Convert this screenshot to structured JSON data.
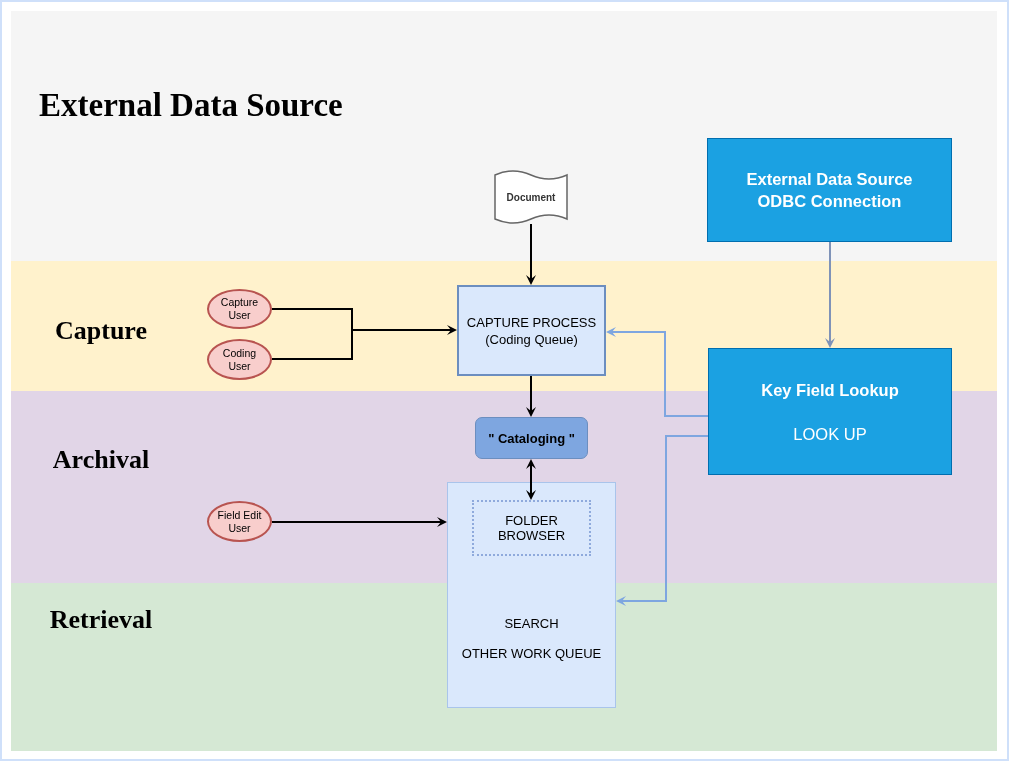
{
  "lanes": [
    {
      "label": "External Data Source",
      "color": "#f5f5f5"
    },
    {
      "label": "Capture",
      "color": "#fff2cc"
    },
    {
      "label": "Archival",
      "color": "#e1d5e7"
    },
    {
      "label": "Retrieval",
      "color": "#d5e8d4"
    }
  ],
  "nodes": [
    {
      "kind": "document",
      "text": "Document"
    },
    {
      "kind": "actor",
      "text": "Capture\nUser"
    },
    {
      "kind": "actor",
      "text": "Coding\nUser"
    },
    {
      "kind": "actor",
      "text": "Field Edit\nUser"
    },
    {
      "kind": "process",
      "text": "CAPTURE PROCESS\n(Coding Queue)"
    },
    {
      "kind": "rounded",
      "text": "\" Cataloging \""
    },
    {
      "kind": "container",
      "inner": "FOLDER\nBROWSER",
      "lines": [
        "SEARCH",
        "OTHER WORK QUEUE"
      ]
    },
    {
      "kind": "service",
      "text": "External Data Source\nODBC Connection"
    },
    {
      "kind": "lookup",
      "title": "Key Field Lookup",
      "subtitle": "LOOK UP"
    }
  ]
}
